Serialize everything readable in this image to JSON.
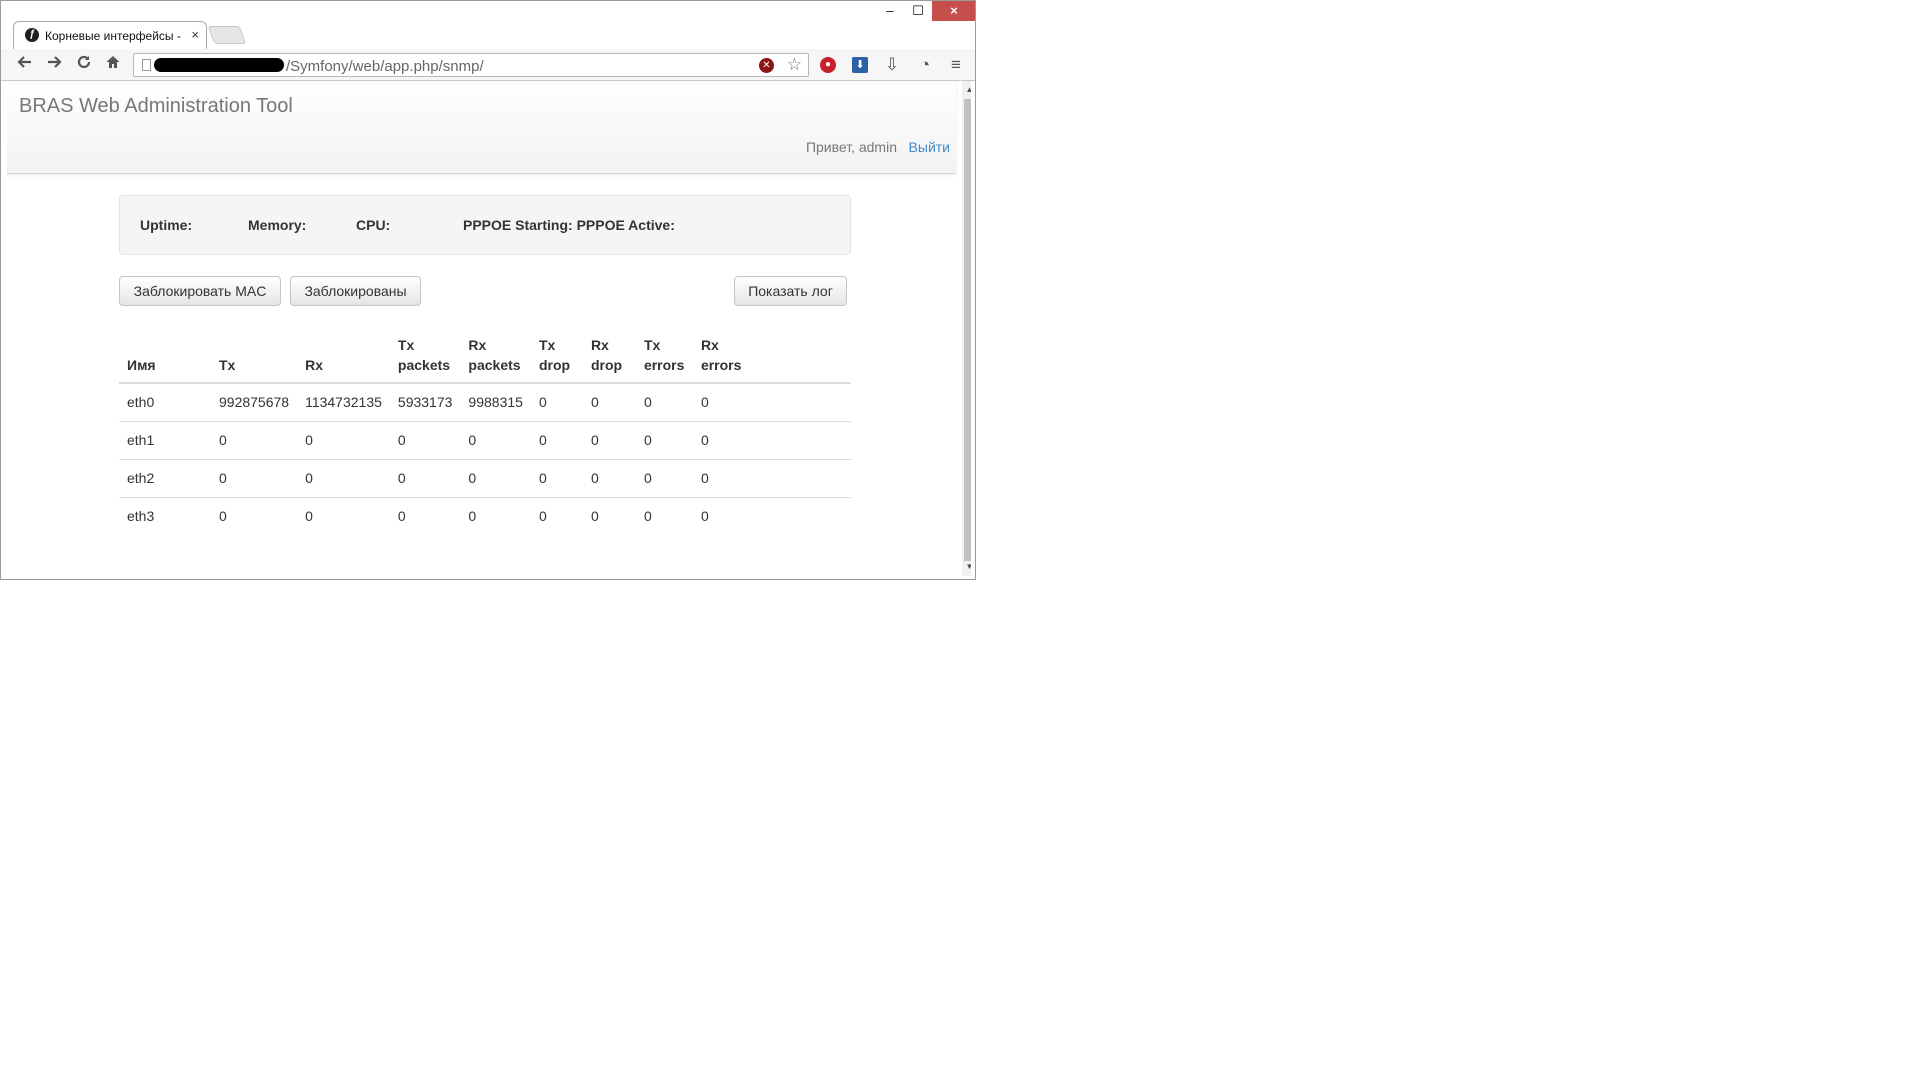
{
  "browser": {
    "tab_title": "Корневые интерфейсы -",
    "tab_close": "×",
    "url_text": "/Symfony/web/app.php/snmp/",
    "window_controls": {
      "minimize": "–",
      "maximize": "☐",
      "close": "×"
    },
    "nav_icons": [
      "back-icon",
      "forward-icon",
      "reload-icon",
      "home-icon"
    ],
    "extension_icons": [
      "stop-red-icon",
      "download-blue-icon",
      "save-icon",
      "accounts-icon",
      "menu-icon"
    ]
  },
  "app": {
    "brand": "BRAS Web Administration Tool",
    "greeting": "Привет, admin",
    "logout": "Выйти"
  },
  "status": {
    "uptime": "Uptime:",
    "memory": "Memory:",
    "cpu": "CPU:",
    "pppoe": "PPPOE Starting: PPPOE Active:"
  },
  "buttons": {
    "block_mac": "Заблокировать MAC",
    "blocked": "Заблокированы",
    "show_log": "Показать лог"
  },
  "table": {
    "headers": [
      [
        "Имя"
      ],
      [
        "Tx"
      ],
      [
        "Rx"
      ],
      [
        "Tx",
        "packets"
      ],
      [
        "Rx",
        "packets"
      ],
      [
        "Tx",
        "drop"
      ],
      [
        "Rx",
        "drop"
      ],
      [
        "Tx",
        "errors"
      ],
      [
        "Rx",
        "errors"
      ]
    ],
    "rows": [
      [
        "eth0",
        "992875678",
        "1134732135",
        "5933173",
        "9988315",
        "0",
        "0",
        "0",
        "0"
      ],
      [
        "eth1",
        "0",
        "0",
        "0",
        "0",
        "0",
        "0",
        "0",
        "0"
      ],
      [
        "eth2",
        "0",
        "0",
        "0",
        "0",
        "0",
        "0",
        "0",
        "0"
      ],
      [
        "eth3",
        "0",
        "0",
        "0",
        "0",
        "0",
        "0",
        "0",
        "0"
      ]
    ]
  },
  "colors": {
    "link": "#428bca",
    "close_button": "#c74f4b",
    "well_background": "#f5f5f5",
    "navbar_border": "#d4d4d4"
  }
}
